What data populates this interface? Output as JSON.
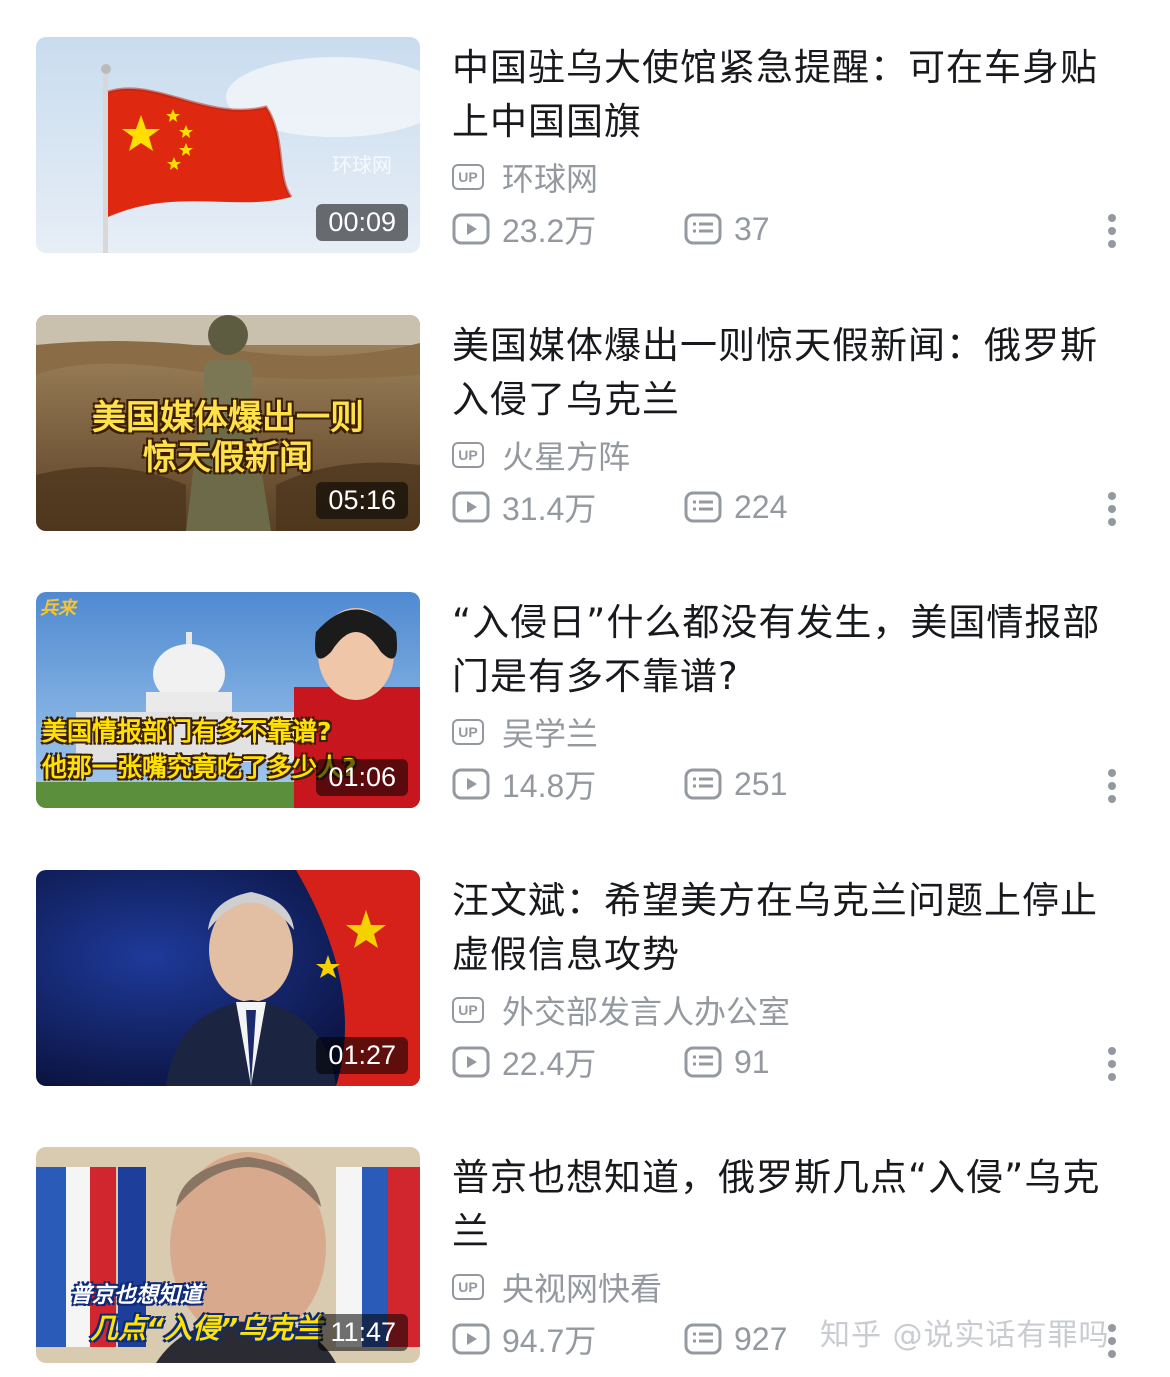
{
  "colors": {
    "text_primary": "#18191c",
    "text_secondary": "#9499a0",
    "background": "#ffffff"
  },
  "videos": [
    {
      "title": "中国驻乌大使馆紧急提醒：可在车身贴上中国国旗",
      "up_badge": "UP",
      "uploader": "环球网",
      "views": "23.2万",
      "danmaku": "37",
      "duration": "00:09",
      "thumb_watermark": "环球网",
      "thumbnail": "chinese-flag"
    },
    {
      "title": "美国媒体爆出一则惊天假新闻：俄罗斯入侵了乌克兰",
      "up_badge": "UP",
      "uploader": "火星方阵",
      "views": "31.4万",
      "danmaku": "224",
      "duration": "05:16",
      "thumb_line1": "美国媒体爆出一则",
      "thumb_line2": "惊天假新闻",
      "thumbnail": "soldier-trench"
    },
    {
      "title": "“入侵日”什么都没有发生，美国情报部门是有多不靠谱?",
      "up_badge": "UP",
      "uploader": "吴学兰",
      "views": "14.8万",
      "danmaku": "251",
      "duration": "01:06",
      "thumb_line1": "美国情报部门有多不靠谱?",
      "thumb_line2": "他那一张嘴究竟吃了多少人?",
      "thumb_logo": "兵来",
      "thumbnail": "capitol-presenter"
    },
    {
      "title": "汪文斌：希望美方在乌克兰问题上停止虚假信息攻势",
      "up_badge": "UP",
      "uploader": "外交部发言人办公室",
      "views": "22.4万",
      "danmaku": "91",
      "duration": "01:27",
      "thumbnail": "spokesman-flag"
    },
    {
      "title": "普京也想知道，俄罗斯几点“入侵”乌克兰",
      "up_badge": "UP",
      "uploader": "央视网快看",
      "views": "94.7万",
      "danmaku": "927",
      "duration": "11:47",
      "thumb_line1": "普京也想知道",
      "thumb_line2": "几点“入侵”乌克兰",
      "thumbnail": "putin-flags"
    }
  ],
  "icons": {
    "play": "play-count-icon",
    "danmaku": "danmaku-count-icon",
    "more": "more-vertical-icon"
  },
  "watermark": "知乎 @说实话有罪吗"
}
